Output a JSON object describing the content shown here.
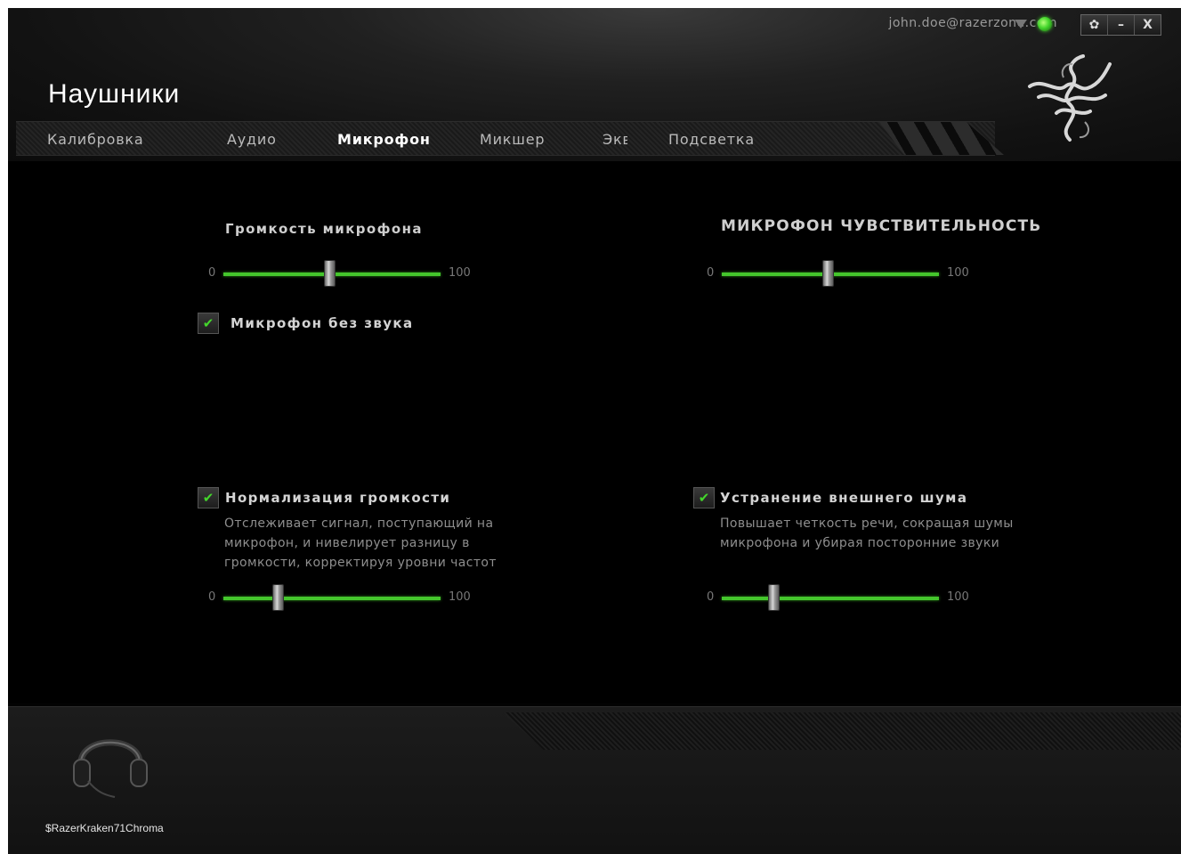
{
  "header": {
    "account_email": "john.doe@razerzone.com",
    "title": "Наушники",
    "window_buttons": [
      "✿",
      "–",
      "X"
    ]
  },
  "tabs": [
    {
      "label": "Калибровка",
      "active": false
    },
    {
      "label": "Аудио",
      "active": false
    },
    {
      "label": "Микрофон",
      "active": true
    },
    {
      "label": "Микшер",
      "active": false
    },
    {
      "label": "Экв",
      "active": false
    },
    {
      "label": "Подсветка",
      "active": false
    }
  ],
  "mic_volume": {
    "title": "Громкость микрофона",
    "min": "0",
    "max": "100",
    "value": 49
  },
  "mic_sensitivity": {
    "title": "МИКРОФОН ЧУВСТВИТЕЛЬНОСТЬ",
    "min": "0",
    "max": "100",
    "value": 49
  },
  "mic_mute": {
    "label": "Микрофон без звука",
    "checked": true
  },
  "volume_normalization": {
    "label": "Нормализация громкости",
    "checked": true,
    "description": [
      "Отслеживает сигнал, поступающий на",
      "микрофон, и нивелирует разницу в",
      "громкости, корректируя уровни частот"
    ],
    "min": "0",
    "max": "100",
    "value": 25
  },
  "noise_cancellation": {
    "label": "Устранение внешнего шума",
    "checked": true,
    "description": [
      "Повышает четкость речи, сокращая шумы",
      "микрофона и убирая посторонние звуки"
    ],
    "min": "0",
    "max": "100",
    "value": 24
  },
  "device": {
    "name": "$RazerKraken71Chroma"
  },
  "colors": {
    "accent": "#44d62c",
    "background": "#000000",
    "text": "#cfcfcf"
  },
  "icons": {
    "status": "status-dot-icon",
    "settings": "gear-icon",
    "minimize": "minimize-icon",
    "close": "close-icon",
    "logo": "razer-snake-logo-icon",
    "device": "headset-icon"
  }
}
